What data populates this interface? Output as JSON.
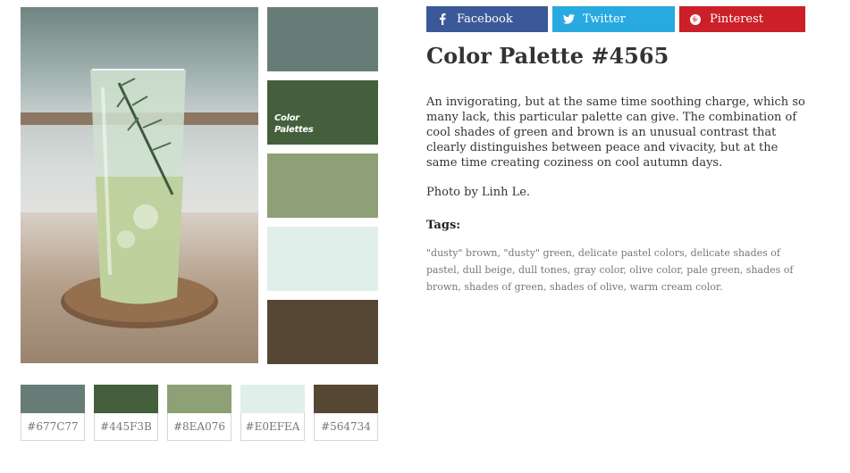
{
  "share": {
    "facebook": "Facebook",
    "twitter": "Twitter",
    "pinterest": "Pinterest"
  },
  "palette": {
    "title": "Color Palette #4565",
    "description": "An invigorating, but at the same time soothing charge, which so many lack, this particular palette can give. The combination of cool shades of green and brown is an unusual contrast that clearly distinguishes between peace and vivacity, but at the same time creating coziness on cool autumn days.",
    "credit": "Photo by Linh Le.",
    "tags_label": "Tags:",
    "tags": "\"dusty\" brown, \"dusty\" green, delicate pastel colors, delicate shades of pastel, dull beige, dull tones, gray color, olive color, pale green, shades of brown, shades of green, shades of olive, warm cream color.",
    "logo_line1": "Color",
    "logo_line2": "Palettes"
  },
  "colors": [
    {
      "hex": "#677C77"
    },
    {
      "hex": "#445F3B"
    },
    {
      "hex": "#8EA076"
    },
    {
      "hex": "#E0EFEA"
    },
    {
      "hex": "#564734"
    }
  ],
  "icons": {
    "facebook": "facebook-icon",
    "twitter": "twitter-icon",
    "pinterest": "pinterest-icon"
  }
}
